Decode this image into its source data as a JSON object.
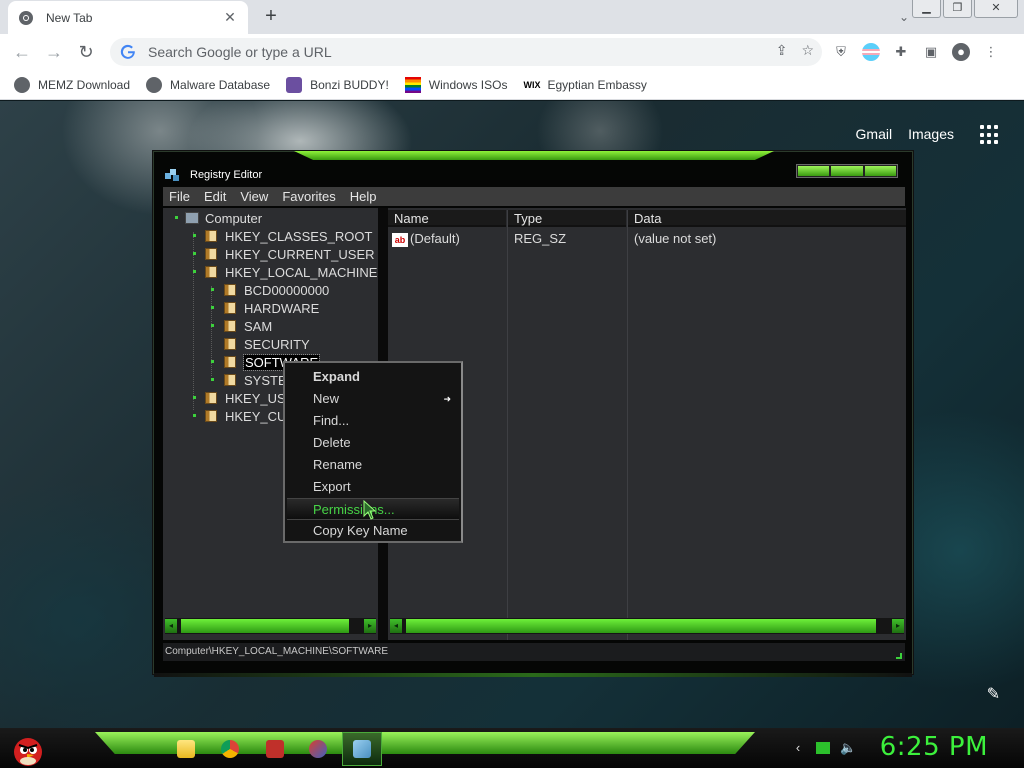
{
  "browser": {
    "tab_title": "New Tab",
    "tab_close": "✕",
    "newtab": "+",
    "omnibox_placeholder": "Search Google or type a URL",
    "bookmarks": [
      {
        "label": "MEMZ Download"
      },
      {
        "label": "Malware Database"
      },
      {
        "label": "Bonzi BUDDY!"
      },
      {
        "label": "Windows ISOs"
      },
      {
        "label": "Egyptian Embassy"
      }
    ]
  },
  "newtab_page": {
    "gmail": "Gmail",
    "images": "Images"
  },
  "regedit": {
    "title": "Registry Editor",
    "menu": [
      "File",
      "Edit",
      "View",
      "Favorites",
      "Help"
    ],
    "tree": {
      "computer": "Computer",
      "hkcr": "HKEY_CLASSES_ROOT",
      "hkcu": "HKEY_CURRENT_USER",
      "hklm": "HKEY_LOCAL_MACHINE",
      "bcd": "BCD00000000",
      "hardware": "HARDWARE",
      "sam": "SAM",
      "security": "SECURITY",
      "software": "SOFTWARE",
      "system": "SYSTE",
      "hku": "HKEY_US",
      "hkcc": "HKEY_CU"
    },
    "columns": {
      "name": "Name",
      "type": "Type",
      "data": "Data"
    },
    "row": {
      "name": "(Default)",
      "type": "REG_SZ",
      "data": "(value not set)",
      "icon_text": "ab"
    },
    "status_path": "Computer\\HKEY_LOCAL_MACHINE\\SOFTWARE"
  },
  "context_menu": {
    "items": [
      "Expand",
      "New",
      "Find...",
      "Delete",
      "Rename",
      "Export",
      "Permissions...",
      "Copy Key Name"
    ]
  },
  "taskbar": {
    "clock": "6:25 PM"
  },
  "colors": {
    "accent_green": "#3cf03c",
    "menu_highlight_text": "#46d446"
  }
}
